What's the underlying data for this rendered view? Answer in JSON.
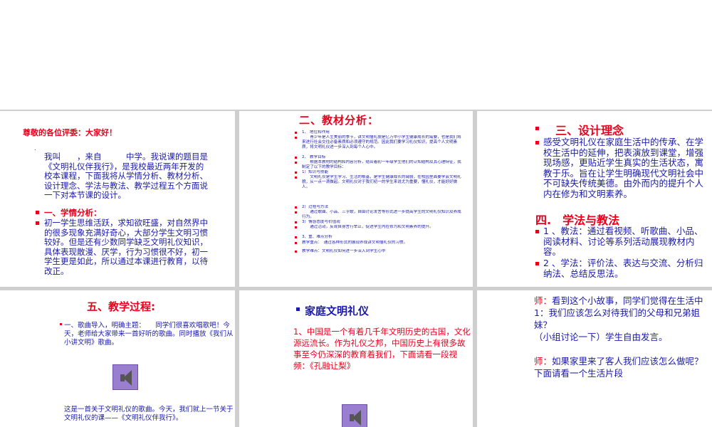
{
  "slide1": {
    "greeting": "尊敬的各位评委：大家好！",
    "dot": ".",
    "intro": "我叫　　，来自　　　中学。我说课的题目是《文明礼仪伴我行》，是我校最近两年开发的校本课程，下面我将从学情分析、教材分析、设计理念、学法与教法、教学过程五个方面说一下对本节课的设计。",
    "heading": "一、学情分析：",
    "analysis": "初一学生思维活跃，求知欲旺盛，对自然界中的很多现象充满好奇心，大部分学生文明习惯较好。但是还有少数同学缺乏文明礼仪知识，具体表现散漫、厌学，行为习惯很不好，初一学生更是如此，所以通过本课进行教育，以待改正。"
  },
  "slide2": {
    "title": "二、教材分析：",
    "items": [
      "1、 地位和作用",
      "　　青少年是人生美丽的季节，讲文明懂礼貌是亿万中小学生健康成长的需要，也是我们将来进行社会交往必备素质和必须遵守的规范。因此我们要学习礼仪知识，提高个人文明素质，将文明礼仪进一步深入到每个人心中。",
      "2、 教学目标",
      "　　根据本教材的结构和内容分析，结合着初一年级学生他们的认知结构及其心理特征，我制定了以下的教学目标：",
      "1）知识与技能",
      "　　文明礼仪是学生学习、生活的根基，是学生健康成长的臂膀，在校园里面要学会文明礼貌，从一点一滴做起。文明礼仪对于我们初一的学生来说尤为重要，懂礼仪，才能好好做人。",
      "2）过程与方法",
      "　　通过歌曲、小品、三字歌，自由讨论发言等形式进一步提高学生的文明礼仪知识及养成行为。",
      "3）情感态度与价值观",
      "　　通过活动，反观自身言行举止，促进学生内在修为和文明素养的提升。",
      "3、重、难点分析",
      "教学重点：　通过各种形式的展现养成讲文明懂礼仪的习惯。",
      "教学难点：文明礼仪如何进一步深入到学生心中"
    ]
  },
  "slide3": {
    "heading1": "三、设计理念",
    "para1": "感受文明礼仪在家庭生活中的传承、在学校生活中的延伸，把表演放到课堂，增强现场感，更贴近学生真实的生活状态，寓教于乐。旨在让学生明确现代文明社会中不可缺失传统美德。由外而内的提升个人内在修为和文明素养。",
    "heading2": "四.　学法与教法",
    "para2": "1 、教法：通过看视频、听歌曲、小品、阅读材料、讨论等系列活动展现教材内容。",
    "para3": "2 、学法：评价法、表达与交流、分析归纳法、总结反思法。"
  },
  "slide4": {
    "heading": "五、教学过程:",
    "para1": "一、歌曲导入，明确主题：　　同学们很喜欢唱歌吧！今天，老师给大家带来一首好听的歌曲。同时播放《我们从小讲文明》歌曲。",
    "para2": "这是一首关于文明礼仪的歌曲。今天，我们就上一节关于文明礼仪的课——《文明礼仪伴我行》。"
  },
  "slide5": {
    "heading": "家庭文明礼仪",
    "para": "1、中国是一个有着几千年文明历史的古国，文化源远流长。作为礼仪之邦，中国历史上有很多故事至今仍深深的教育着我们，下面请看一段视频：《孔融让梨》"
  },
  "slide6": {
    "teacher1": "师：",
    "text1": "看到这个小故事，同学们觉得在生活中",
    "q1": "1：我们应该怎么对待我们的父母和兄弟姐妹？",
    "q2": "（小组讨论一下）学生自由发言。",
    "teacher2": "师：",
    "text2": "如果家里来了客人我们应该怎么做呢？下面请看一个生活片段"
  },
  "colors": {
    "red": "#e8001c",
    "blue": "#1a1aa6",
    "background": "#cfcfcf"
  }
}
